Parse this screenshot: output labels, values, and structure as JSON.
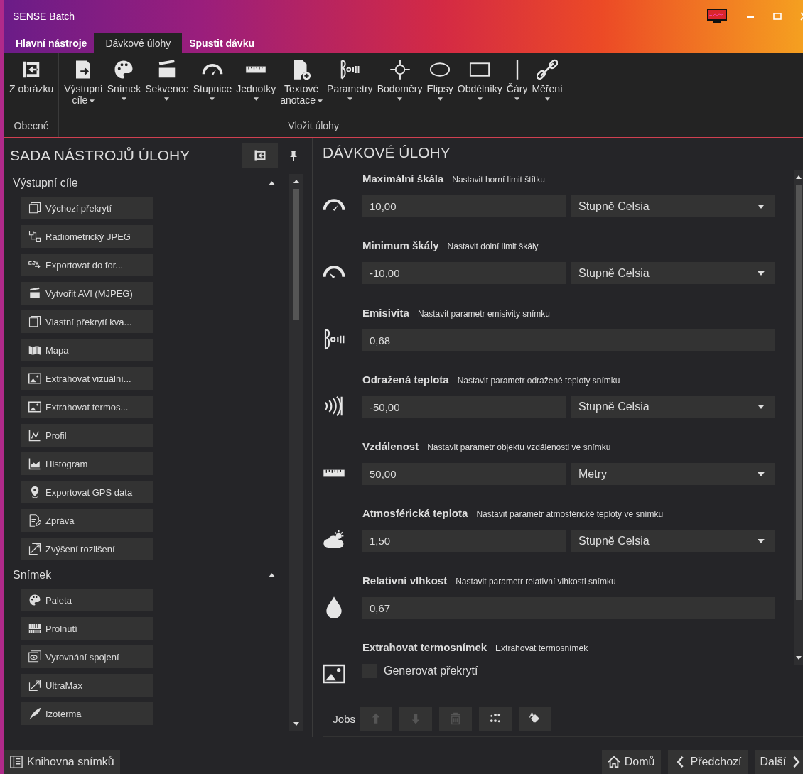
{
  "window": {
    "title": "SENSE Batch"
  },
  "tabs": [
    {
      "label": "Hlavní nástroje",
      "selected": false
    },
    {
      "label": "Dávkové úlohy",
      "selected": true
    },
    {
      "label": "Spustit dávku",
      "selected": false
    }
  ],
  "ribbon": [
    {
      "label": "Obecné",
      "buttons": [
        {
          "label": "Z obrázku",
          "dropdown": false
        }
      ]
    },
    {
      "label": "Vložit úlohy",
      "buttons": [
        {
          "label": "Výstupní\ncíle",
          "dropdown": true
        },
        {
          "label": "Snímek",
          "dropdown": true
        },
        {
          "label": "Sekvence",
          "dropdown": true
        },
        {
          "label": "Stupnice",
          "dropdown": true
        },
        {
          "label": "Jednotky",
          "dropdown": true
        },
        {
          "label": "Textové\nanotace",
          "dropdown": true
        },
        {
          "label": "Parametry",
          "dropdown": true
        },
        {
          "label": "Bodoměry",
          "dropdown": true
        },
        {
          "label": "Elipsy",
          "dropdown": true
        },
        {
          "label": "Obdélníky",
          "dropdown": true
        },
        {
          "label": "Čáry",
          "dropdown": true
        },
        {
          "label": "Měření",
          "dropdown": true
        }
      ]
    }
  ],
  "toolbox": {
    "title": "SADA NÁSTROJŮ ÚLOHY",
    "sections": [
      {
        "label": "Výstupní cíle",
        "expanded": true,
        "items": [
          "Výchozí překrytí",
          "Radiometrický JPEG",
          "Exportovat do for...",
          "Vytvořit AVI (MJPEG)",
          "Vlastní překrytí kva...",
          "Mapa",
          "Extrahovat vizuální...",
          "Extrahovat termos...",
          "Profil",
          "Histogram",
          "Exportovat GPS data",
          "Zpráva",
          "Zvýšení rozlišení"
        ]
      },
      {
        "label": "Snímek",
        "expanded": true,
        "items": [
          "Paleta",
          "Prolnutí",
          "Vyrovnání spojení",
          "UltraMax",
          "Izoterma"
        ]
      }
    ]
  },
  "jobs": {
    "title": "DÁVKOVÉ ÚLOHY",
    "items": [
      {
        "title": "Maximální škála",
        "description": "Nastavit horní limit štítku",
        "kind": "value_unit",
        "value": "10,00",
        "unit": "Stupně Celsia"
      },
      {
        "title": "Minimum škály",
        "description": "Nastavit dolní limit škály",
        "kind": "value_unit",
        "value": "-10,00",
        "unit": "Stupně Celsia"
      },
      {
        "title": "Emisivita",
        "description": "Nastavit parametr emisivity snímku",
        "kind": "value",
        "value": "0,68"
      },
      {
        "title": "Odražená teplota",
        "description": "Nastavit parametr odražené teploty snímku",
        "kind": "value_unit",
        "value": "-50,00",
        "unit": "Stupně Celsia"
      },
      {
        "title": "Vzdálenost",
        "description": "Nastavit parametr objektu vzdálenosti ve snímku",
        "kind": "value_unit",
        "value": "50,00",
        "unit": "Metry"
      },
      {
        "title": "Atmosférická teplota",
        "description": "Nastavit parametr atmosférické teploty ve snímku",
        "kind": "value_unit",
        "value": "1,50",
        "unit": "Stupně Celsia"
      },
      {
        "title": "Relativní vlhkost",
        "description": "Nastavit parametr relativní vlhkosti snímku",
        "kind": "value",
        "value": "0,67"
      },
      {
        "title": "Extrahovat termosnímek",
        "description": "Extrahovat termosnímek",
        "kind": "checkbox",
        "option": {
          "label": "Generovat překrytí",
          "checked": false
        }
      }
    ]
  },
  "jobs_toolbar": {
    "label": "Jobs",
    "buttons": [
      {
        "disabled": true
      },
      {
        "disabled": true
      },
      {
        "disabled": true
      },
      {
        "disabled": false
      },
      {
        "disabled": false
      }
    ]
  },
  "footer": {
    "library": "Knihovna snímků",
    "home": "Domů",
    "previous": "Předchozí",
    "next": "Další"
  }
}
